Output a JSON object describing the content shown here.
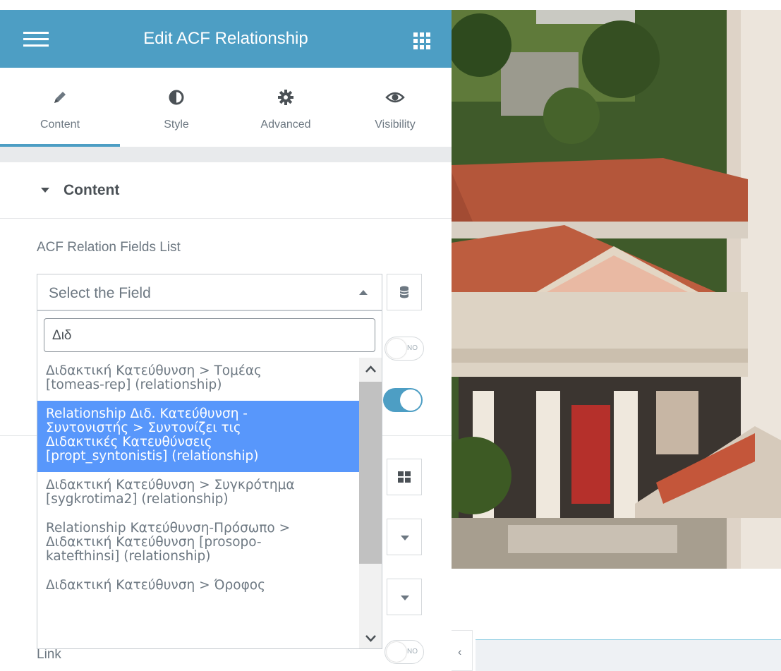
{
  "header": {
    "title": "Edit ACF Relationship",
    "menu_icon": "hamburger-icon",
    "apps_icon": "grid-icon"
  },
  "tabs": [
    {
      "label": "Content",
      "icon": "pencil-icon",
      "active": true
    },
    {
      "label": "Style",
      "icon": "half-circle-icon",
      "active": false
    },
    {
      "label": "Advanced",
      "icon": "gear-icon",
      "active": false
    },
    {
      "label": "Visibility",
      "icon": "eye-icon",
      "active": false
    }
  ],
  "section": {
    "title": "Content"
  },
  "field": {
    "label": "ACF Relation Fields List",
    "selected": "Select the Field",
    "search_query": "Διδ",
    "options": [
      {
        "lines": [
          "Διδακτική Κατεύθυνση > Τομέας",
          "[tomeas-rep] (relationship)"
        ],
        "selected": false
      },
      {
        "lines": [
          "Relationship Διδ. Κατεύθυνση -",
          "Συντονιστής > Συντονίζει τις",
          "Διδακτικές Κατευθύνσεις",
          "[propt_syntonistis] (relationship)"
        ],
        "selected": true
      },
      {
        "lines": [
          "Διδακτική Κατεύθυνση > Συγκρότημα",
          "[sygkrotima2] (relationship)"
        ],
        "selected": false
      },
      {
        "lines": [
          "Relationship Κατεύθυνση-Πρόσωπο >",
          "Διδακτική Κατεύθυνση [prosopo-",
          "katefthinsi] (relationship)"
        ],
        "selected": false
      },
      {
        "lines": [
          "Διδακτική Κατεύθυνση > Όροφος"
        ],
        "selected": false
      }
    ]
  },
  "toggles": {
    "first_off_label": "NO",
    "link_off_label": "NO"
  },
  "link_label": "Link",
  "preview": {
    "collapse_glyph": "‹"
  },
  "colors": {
    "accent": "#4d9ec4",
    "option_highlight": "#5897fb",
    "text": "#6d7882",
    "roof": "#b4563a"
  }
}
